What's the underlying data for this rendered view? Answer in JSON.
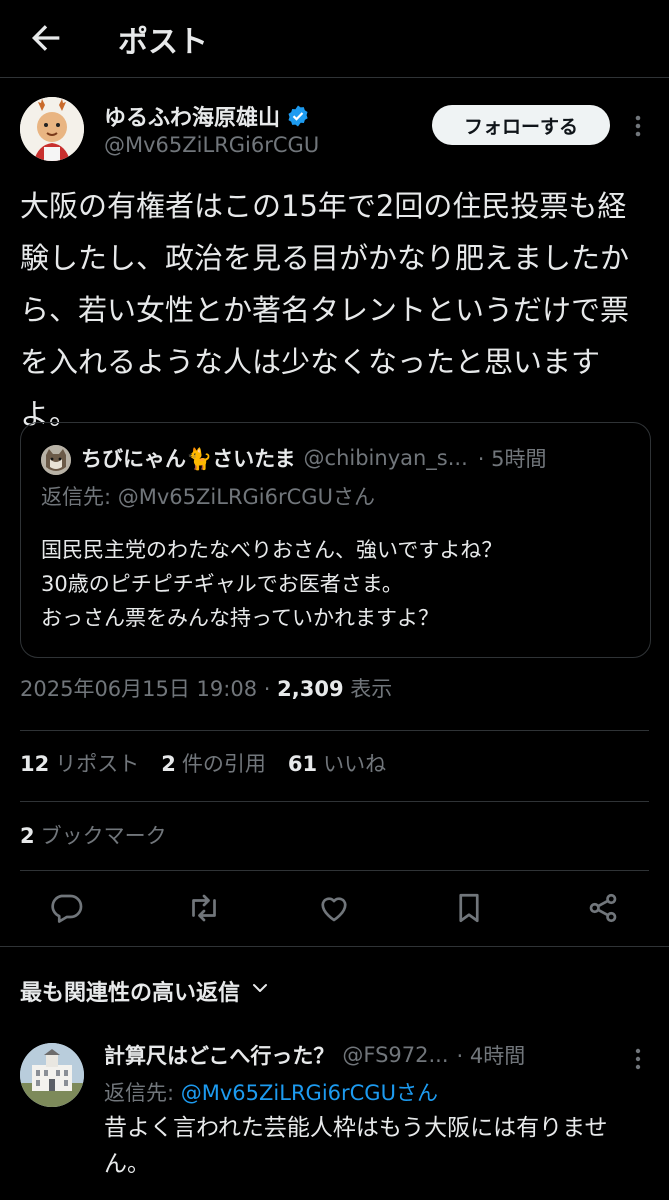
{
  "header": {
    "title": "ポスト"
  },
  "tweet": {
    "author_name": "ゆるふわ海原雄山",
    "author_handle": "@Mv65ZiLRGi6rCGU",
    "follow_label": "フォローする",
    "text": "大阪の有権者はこの15年で2回の住民投票も経験したし、政治を見る目がかなり肥えましたから、若い女性とか著名タレントというだけで票を入れるような人は少なくなったと思いますよ。",
    "timestamp": "2025年06月15日 19:08",
    "separator": "·",
    "views_count": "2,309",
    "views_label": "表示"
  },
  "quote": {
    "name": "ちびにゃん🐈さいたま",
    "handle": "@chibinyan_s...",
    "time": "· 5時間",
    "reply_to": "返信先: @Mv65ZiLRGi6rCGUさん",
    "lines": [
      "国民民主党のわたなべりおさん、強いですよね？",
      "30歳のピチピチギャルでお医者さま。",
      "おっさん票をみんな持っていかれますよ？"
    ]
  },
  "stats": {
    "reposts_count": "12",
    "reposts_label": "リポスト",
    "quotes_count": "2",
    "quotes_label": "件の引用",
    "likes_count": "61",
    "likes_label": "いいね",
    "bookmarks_count": "2",
    "bookmarks_label": "ブックマーク"
  },
  "actions": [
    "reply-icon",
    "repost-icon",
    "like-icon",
    "bookmark-icon",
    "share-icon"
  ],
  "replies": {
    "sort_label": "最も関連性の高い返信",
    "items": [
      {
        "name": "計算尺はどこへ行った？",
        "handle": "@FS972...",
        "time": "· 4時間",
        "reply_prefix": "返信先: ",
        "reply_to": "@Mv65ZiLRGi6rCGUさん",
        "text": "昔よく言われた芸能人枠はもう大阪には有りません。"
      }
    ]
  },
  "colors": {
    "background": "#000000",
    "text": "#e7e9ea",
    "muted": "#71767b",
    "accent": "#1d9bf0",
    "border": "#2f3336"
  }
}
